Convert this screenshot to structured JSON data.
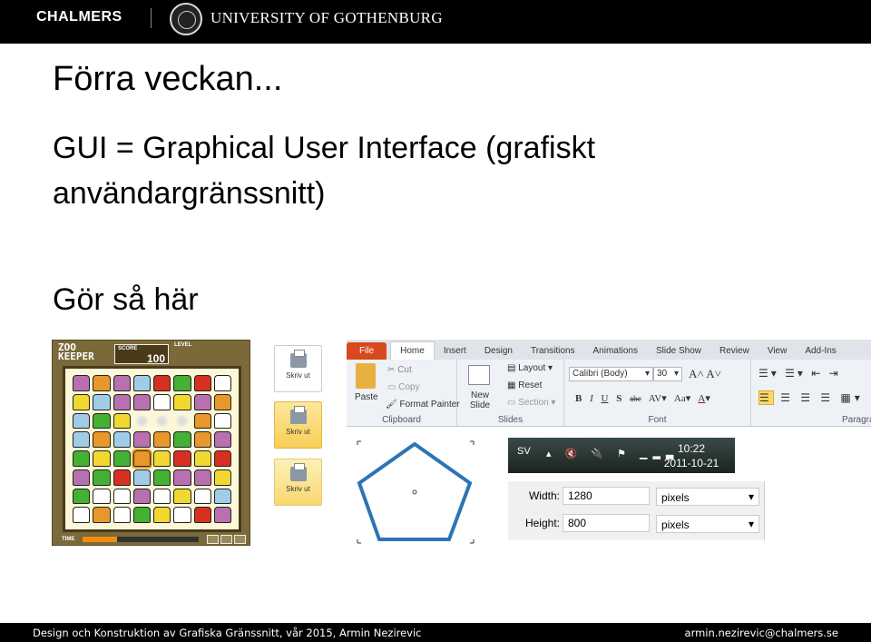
{
  "header": {
    "left_logo": "CHALMERS",
    "right_logo": "UNIVERSITY OF GOTHENBURG"
  },
  "slide": {
    "title": "Förra veckan...",
    "line1": "GUI = Graphical User Interface (grafiskt användargränssnitt)",
    "line2": "Gör så här"
  },
  "game": {
    "logo_line1": "ZOO",
    "logo_line2": "KEEPER",
    "score_label": "SCORE",
    "score": "100",
    "level_label": "LEVEL",
    "time_label": "TIME",
    "time_fraction": 0.3,
    "animal_colors": {
      "hippo": "#b870b0",
      "lion": "#e8982a",
      "elephant": "#a0cce8",
      "bear": "#d83020",
      "frog": "#44b034",
      "panda": "#ffffff",
      "giraffe": "#f0d830"
    },
    "board": [
      [
        "hippo",
        "lion",
        "hippo",
        "elephant",
        "bear",
        "frog",
        "bear",
        "panda"
      ],
      [
        "giraffe",
        "elephant",
        "hippo",
        "hippo",
        "panda",
        "giraffe",
        "hippo",
        "lion"
      ],
      [
        "elephant",
        "frog",
        "giraffe",
        "spark",
        "spark",
        "spark",
        "lion",
        "panda"
      ],
      [
        "elephant",
        "lion",
        "elephant",
        "hippo",
        "lion",
        "frog",
        "lion",
        "hippo"
      ],
      [
        "frog",
        "giraffe",
        "frog",
        "lion*",
        "giraffe",
        "bear",
        "giraffe",
        "bear"
      ],
      [
        "hippo",
        "frog",
        "bear",
        "elephant",
        "frog",
        "hippo",
        "hippo",
        "giraffe"
      ],
      [
        "frog",
        "panda",
        "panda",
        "hippo",
        "panda",
        "giraffe",
        "panda",
        "elephant"
      ],
      [
        "panda",
        "lion",
        "panda",
        "frog",
        "giraffe",
        "panda",
        "bear",
        "hippo"
      ]
    ]
  },
  "print_buttons": [
    {
      "label": "Skriv ut",
      "state": "normal"
    },
    {
      "label": "Skriv ut",
      "state": "pressed"
    },
    {
      "label": "Skriv ut",
      "state": "hover"
    }
  ],
  "ribbon": {
    "tabs": [
      "File",
      "Home",
      "Insert",
      "Design",
      "Transitions",
      "Animations",
      "Slide Show",
      "Review",
      "View",
      "Add-Ins"
    ],
    "clipboard": {
      "paste": "Paste",
      "cut": "Cut",
      "copy": "Copy",
      "format_painter": "Format Painter",
      "label": "Clipboard"
    },
    "slides": {
      "new_slide": "New Slide",
      "layout": "Layout",
      "reset": "Reset",
      "section": "Section",
      "label": "Slides"
    },
    "font": {
      "family": "Calibri (Body)",
      "size": "30",
      "label": "Font",
      "bold": "B",
      "italic": "I",
      "underline": "U",
      "shadow": "S",
      "strike": "abc",
      "spacing": "AV",
      "case": "Aa",
      "color": "A"
    },
    "paragraph": {
      "label": "Paragraph"
    }
  },
  "taskbar": {
    "language": "SV",
    "time": "10:22",
    "date": "2011-10-21"
  },
  "size_dialog": {
    "width_label": "Width:",
    "width_value": "1280",
    "width_unit": "pixels",
    "height_label": "Height:",
    "height_value": "800",
    "height_unit": "pixels"
  },
  "footer": {
    "left": "Design och Konstruktion av Grafiska Gränssnitt,  vår 2015, Armin Nezirevic",
    "right": "armin.nezirevic@chalmers.se"
  }
}
